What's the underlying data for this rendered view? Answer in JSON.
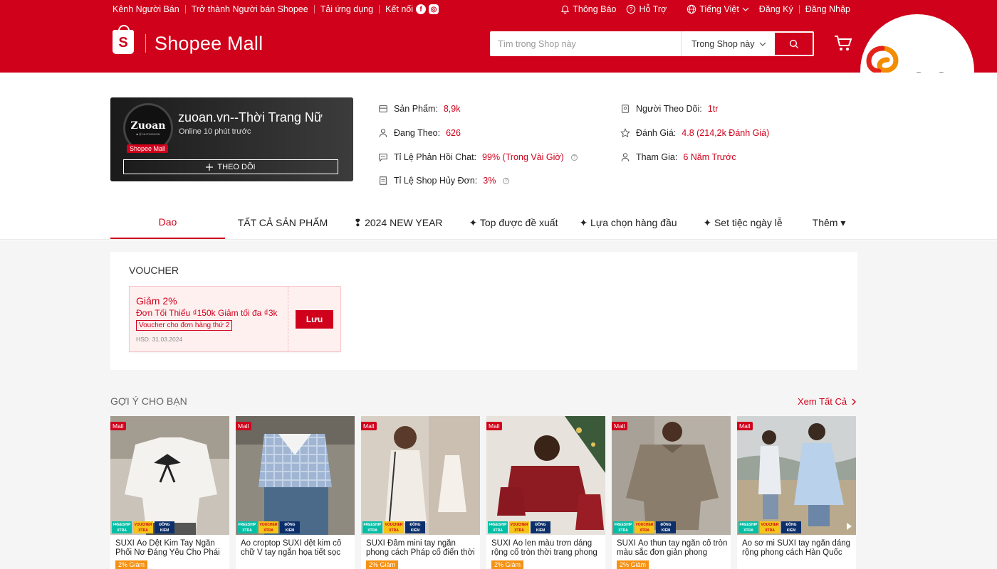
{
  "header": {
    "nav_left": [
      "Kênh Người Bán",
      "Trở thành Người bán Shopee",
      "Tải ứng dụng",
      "Kết nối"
    ],
    "social": [
      "f",
      "◎"
    ],
    "notifications": "Thông Báo",
    "help": "Hỗ Trợ",
    "language": "Tiếng Việt",
    "register": "Đăng Ký",
    "login": "Đăng Nhập",
    "logo_text": "Shopee Mall",
    "search_placeholder": "Tìm trong Shop này",
    "search_scope": "Trong Shop này"
  },
  "watermark": "adpia",
  "shop": {
    "avatar_brand": "Zuoan",
    "avatar_sub": "■ Ⓜ NU FASHION",
    "mall_tag": "Shopee Mall",
    "name": "zuoan.vn--Thời Trang Nữ",
    "online": "Online 10 phút trước",
    "follow_label": "THEO DÕI",
    "stats": {
      "products_label": "Sản Phẩm:",
      "products_value": "8,9k",
      "following_label": "Đang Theo:",
      "following_value": "626",
      "chat_label": "Tỉ Lệ Phản Hồi Chat:",
      "chat_value": "99% (Trong Vài Giờ)",
      "cancel_label": "Tỉ Lệ Shop Hủy Đơn:",
      "cancel_value": "3%",
      "followers_label": "Người Theo Dõi:",
      "followers_value": "1tr",
      "rating_label": "Đánh Giá:",
      "rating_value": "4.8 (214,2k Đánh Giá)",
      "joined_label": "Tham Gia:",
      "joined_value": "6 Năm Trước"
    }
  },
  "tabs": [
    "Dao",
    "TẤT CẢ SẢN PHẨM",
    "❢ 2024 NEW YEAR",
    "✦ Top được đề xuất",
    "✦ Lựa chọn hàng đầu",
    "✦ Set tiệc ngày lễ",
    "Thêm ▾"
  ],
  "voucher": {
    "section_title": "VOUCHER",
    "discount": "Giảm 2%",
    "condition": "Đơn Tối Thiểu ₫150k Giảm tối đa ₫3k",
    "tag": "Voucher cho đơn hàng thứ 2",
    "expiry": "HSD: 31.03.2024",
    "save_label": "Lưu"
  },
  "suggestions": {
    "title": "GỢI Ý CHO BẠN",
    "see_all": "Xem Tất Cả",
    "mall_label": "Mall",
    "badges": {
      "free": "FREESHIP XTRA",
      "voucher": "VOUCHER XTRA",
      "check": "ĐỒNG KIỂM"
    },
    "products": [
      {
        "name": "SUXI Áo Dệt Kim Tay Ngắn Phối Nơ Đáng Yêu Cho Phái Nữ",
        "discount": "2% Giảm"
      },
      {
        "name": "Áo croptop SUXI dệt kim cổ chữ V tay ngắn họa tiết sọc caro th...",
        "discount": ""
      },
      {
        "name": "SUXI Đầm mini tay ngắn phong cách Pháp cổ điển thời trang...",
        "discount": "2% Giảm"
      },
      {
        "name": "SUXI Áo len màu trơn dáng rộng cổ tròn thời trang phong cách...",
        "discount": "2% Giảm"
      },
      {
        "name": "SUXI Áo thun tay ngắn cổ tròn màu sắc đơn giản phong cách...",
        "discount": "2% Giảm"
      },
      {
        "name": "Áo sơ mi SUXI tay ngắn dáng rộng phong cách Hàn Quốc th...",
        "discount": ""
      }
    ]
  },
  "colors": {
    "brand": "#d0011b",
    "discount": "#f69113"
  }
}
